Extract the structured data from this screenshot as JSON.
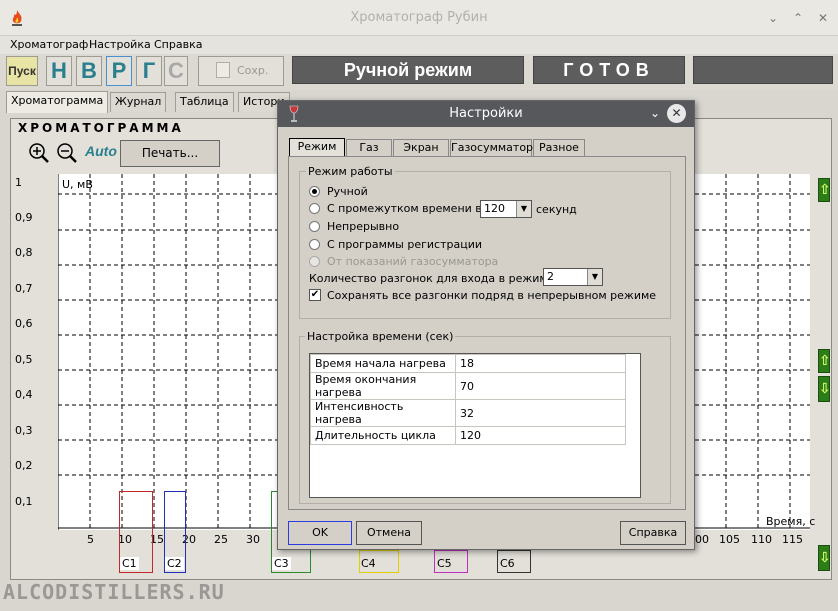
{
  "window": {
    "title": "Хроматограф Рубин"
  },
  "menu": [
    "Хроматограф",
    "Настройка",
    "Справка"
  ],
  "toolbar": {
    "start": "Пуск",
    "letters": [
      "Н",
      "В",
      "Р",
      "Г",
      "С"
    ],
    "save": "Сохр.",
    "mode": "Ручной режим",
    "status": "ГОТОВ"
  },
  "tabs": [
    "Хроматограмма",
    "Журнал",
    "Таблица",
    "Истори"
  ],
  "chrom": {
    "header": "ХРОМАТОГРАММА",
    "auto_label": "Auto",
    "print": "Печать...",
    "yunit": "U, мВ",
    "xunit": "Время, с",
    "yticks": [
      "1",
      "0,9",
      "0,8",
      "0,7",
      "0,6",
      "0,5",
      "0,4",
      "0,3",
      "0,2",
      "0,1"
    ],
    "xticks": [
      "5",
      "10",
      "15",
      "20",
      "25",
      "30",
      "100",
      "105",
      "110",
      "115"
    ],
    "peaks": [
      "C1",
      "C2",
      "C3",
      "C4",
      "C5",
      "C6"
    ]
  },
  "dialog": {
    "title": "Настройки",
    "tabs": [
      "Режим",
      "Газ",
      "Экран",
      "Газосумматор",
      "Разное"
    ],
    "mode_group": "Режим работы",
    "radios": [
      "Ручной",
      "С промежутком времени в",
      "Непрерывно",
      "С программы регистрации",
      "От показаний газосумматора"
    ],
    "interval_value": "120",
    "interval_unit": "секунд",
    "runs_label": "Количество разгонок для входа в режим",
    "runs_value": "2",
    "save_runs": "Сохранять все разгонки подряд в непрерывном режиме",
    "time_group": "Настройка времени (сек)",
    "time_rows": [
      {
        "label": "Время начала нагрева",
        "value": "18"
      },
      {
        "label": "Время окончания нагрева",
        "value": "70"
      },
      {
        "label": "Интенсивность нагрева",
        "value": "32"
      },
      {
        "label": "Длительность цикла",
        "value": "120"
      }
    ],
    "ok": "OK",
    "cancel": "Отмена",
    "help": "Справка"
  },
  "watermark": "ALCODISTILLERS.RU"
}
